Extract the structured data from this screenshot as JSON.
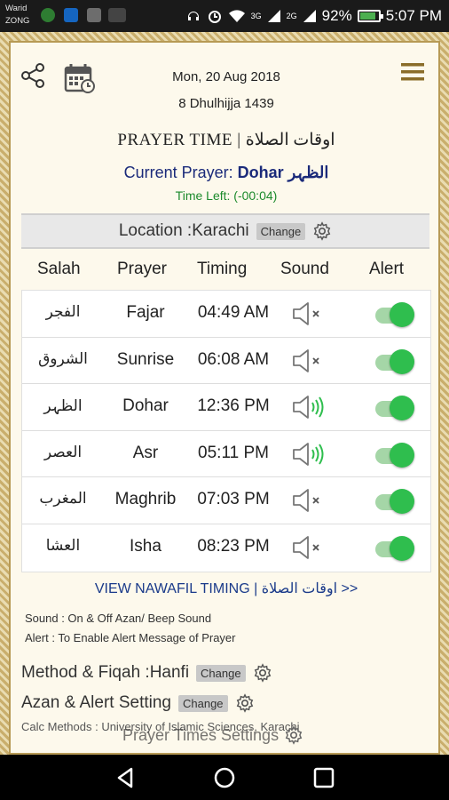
{
  "status_bar": {
    "carrier1": "Warid",
    "carrier2": "ZONG",
    "signal1_label": "3G",
    "signal2_label": "2G",
    "battery": "92%",
    "time": "5:07 PM"
  },
  "header": {
    "date": "Mon, 20 Aug 2018",
    "hijri_date": "8 Dhulhijja 1439",
    "title": "PRAYER TIME | اوقات الصلاة",
    "current_prayer_label": "Current Prayer:",
    "current_prayer_value": "Dohar الظہر",
    "time_left": "Time Left:  (-00:04)"
  },
  "location": {
    "label": "Location :Karachi",
    "change": "Change"
  },
  "table": {
    "headers": [
      "Salah",
      "Prayer",
      "Timing",
      "Sound",
      "Alert"
    ],
    "rows": [
      {
        "urdu": "الفجر",
        "prayer": "Fajar",
        "time": "04:49 AM",
        "sound": "muted",
        "alert": true
      },
      {
        "urdu": "الشروق",
        "prayer": "Sunrise",
        "time": "06:08 AM",
        "sound": "muted",
        "alert": true
      },
      {
        "urdu": "الظہر",
        "prayer": "Dohar",
        "time": "12:36 PM",
        "sound": "on",
        "alert": true
      },
      {
        "urdu": "العصر",
        "prayer": "Asr",
        "time": "05:11 PM",
        "sound": "on",
        "alert": true
      },
      {
        "urdu": "المغرب",
        "prayer": "Maghrib",
        "time": "07:03 PM",
        "sound": "muted",
        "alert": true
      },
      {
        "urdu": "العشا",
        "prayer": "Isha",
        "time": "08:23 PM",
        "sound": "muted",
        "alert": true
      }
    ]
  },
  "nawafil": {
    "label": "VIEW NAWAFIL TIMING  |  اوقات الصلاة  >>"
  },
  "legend": {
    "sound": "Sound : On & Off Azan/ Beep Sound",
    "alert": "Alert : To Enable Alert Message of Prayer"
  },
  "settings": {
    "method_label": "Method & Fiqah :Hanfi",
    "method_change": "Change",
    "azan_label": "Azan & Alert Setting",
    "azan_change": "Change",
    "calc_methods": "Calc Methods : University of Islamic Sciences, Karachi",
    "prayer_times_settings": "Prayer Times Settings"
  },
  "colors": {
    "accent_green": "#2fbe4e",
    "title_blue": "#1a2a7a",
    "time_left_green": "#1c8a2c",
    "frame_gold": "#c9ae6c"
  }
}
